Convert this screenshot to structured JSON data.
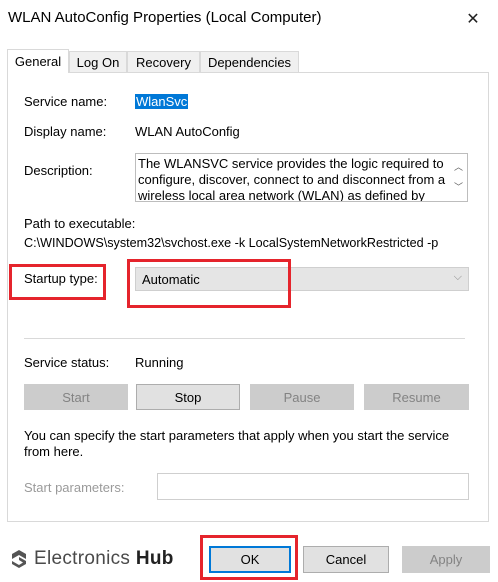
{
  "window": {
    "title": "WLAN AutoConfig Properties (Local Computer)",
    "close_glyph": "✕"
  },
  "tabs": [
    {
      "label": "General",
      "active": true
    },
    {
      "label": "Log On",
      "active": false
    },
    {
      "label": "Recovery",
      "active": false
    },
    {
      "label": "Dependencies",
      "active": false
    }
  ],
  "general": {
    "service_name_label": "Service name:",
    "service_name_value": "WlanSvc",
    "display_name_label": "Display name:",
    "display_name_value": "WLAN AutoConfig",
    "description_label": "Description:",
    "description_value": "The WLANSVC service provides the logic required to configure, discover, connect to and disconnect from a wireless local area network (WLAN) as defined by",
    "path_label": "Path to executable:",
    "path_value": "C:\\WINDOWS\\system32\\svchost.exe -k LocalSystemNetworkRestricted -p",
    "startup_type_label": "Startup type:",
    "startup_type_value": "Automatic",
    "service_status_label": "Service status:",
    "service_status_value": "Running",
    "buttons": {
      "start": "Start",
      "stop": "Stop",
      "pause": "Pause",
      "resume": "Resume"
    },
    "start_params_info": "You can specify the start parameters that apply when you start the service from here.",
    "start_params_label": "Start parameters:",
    "start_params_value": ""
  },
  "footer": {
    "ok": "OK",
    "cancel": "Cancel",
    "apply": "Apply"
  },
  "watermark": {
    "brand_light": "Electronics ",
    "brand_bold": "Hub"
  },
  "colors": {
    "highlight": "#e5242c",
    "selection": "#0078d7"
  }
}
